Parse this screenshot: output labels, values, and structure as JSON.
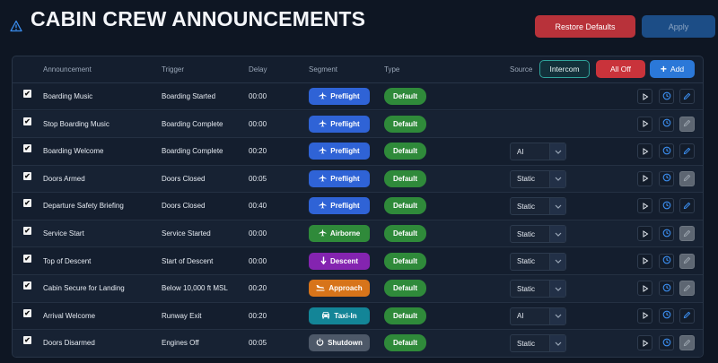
{
  "page": {
    "title": "CABIN CREW ANNOUNCEMENTS"
  },
  "toolbar": {
    "restore_label": "Restore Defaults",
    "apply_label": "Apply"
  },
  "table": {
    "headers": {
      "announcement": "Announcement",
      "trigger": "Trigger",
      "delay": "Delay",
      "segment": "Segment",
      "type": "Type",
      "source": "Source"
    },
    "intercom_label": "Intercom",
    "all_off_label": "All Off",
    "add_label": "Add",
    "rows": [
      {
        "checked": true,
        "announcement": "Boarding Music",
        "trigger": "Boarding Started",
        "delay": "00:00",
        "segment": "Preflight",
        "segment_icon": "plane-icon",
        "segment_color": "#2f63d6",
        "type": "Default",
        "source": "",
        "edit_enabled": true
      },
      {
        "checked": true,
        "announcement": "Stop Boarding Music",
        "trigger": "Boarding Complete",
        "delay": "00:00",
        "segment": "Preflight",
        "segment_icon": "plane-icon",
        "segment_color": "#2f63d6",
        "type": "Default",
        "source": "",
        "edit_enabled": false
      },
      {
        "checked": true,
        "announcement": "Boarding Welcome",
        "trigger": "Boarding Complete",
        "delay": "00:20",
        "segment": "Preflight",
        "segment_icon": "plane-icon",
        "segment_color": "#2f63d6",
        "type": "Default",
        "source": "AI",
        "edit_enabled": true
      },
      {
        "checked": true,
        "announcement": "Doors Armed",
        "trigger": "Doors Closed",
        "delay": "00:05",
        "segment": "Preflight",
        "segment_icon": "plane-icon",
        "segment_color": "#2f63d6",
        "type": "Default",
        "source": "Static",
        "edit_enabled": false
      },
      {
        "checked": true,
        "announcement": "Departure Safety Briefing",
        "trigger": "Doors Closed",
        "delay": "00:40",
        "segment": "Preflight",
        "segment_icon": "plane-icon",
        "segment_color": "#2f63d6",
        "type": "Default",
        "source": "Static",
        "edit_enabled": true
      },
      {
        "checked": true,
        "announcement": "Service Start",
        "trigger": "Service Started",
        "delay": "00:00",
        "segment": "Airborne",
        "segment_icon": "plane-icon",
        "segment_color": "#2f8a3a",
        "type": "Default",
        "source": "Static",
        "edit_enabled": false
      },
      {
        "checked": true,
        "announcement": "Top of Descent",
        "trigger": "Start of Descent",
        "delay": "00:00",
        "segment": "Descent",
        "segment_icon": "down-arrow-icon",
        "segment_color": "#8424b0",
        "type": "Default",
        "source": "Static",
        "edit_enabled": false
      },
      {
        "checked": true,
        "announcement": "Cabin Secure for Landing",
        "trigger": "Below 10,000 ft MSL",
        "delay": "00:20",
        "segment": "Approach",
        "segment_icon": "plane-landing-icon",
        "segment_color": "#d7741a",
        "type": "Default",
        "source": "Static",
        "edit_enabled": false
      },
      {
        "checked": true,
        "announcement": "Arrival Welcome",
        "trigger": "Runway Exit",
        "delay": "00:20",
        "segment": "Taxi-In",
        "segment_icon": "car-icon",
        "segment_color": "#138597",
        "type": "Default",
        "source": "AI",
        "edit_enabled": true
      },
      {
        "checked": true,
        "announcement": "Doors Disarmed",
        "trigger": "Engines Off",
        "delay": "00:05",
        "segment": "Shutdown",
        "segment_icon": "power-icon",
        "segment_color": "#4d5868",
        "type": "Default",
        "source": "Static",
        "edit_enabled": false
      }
    ]
  }
}
